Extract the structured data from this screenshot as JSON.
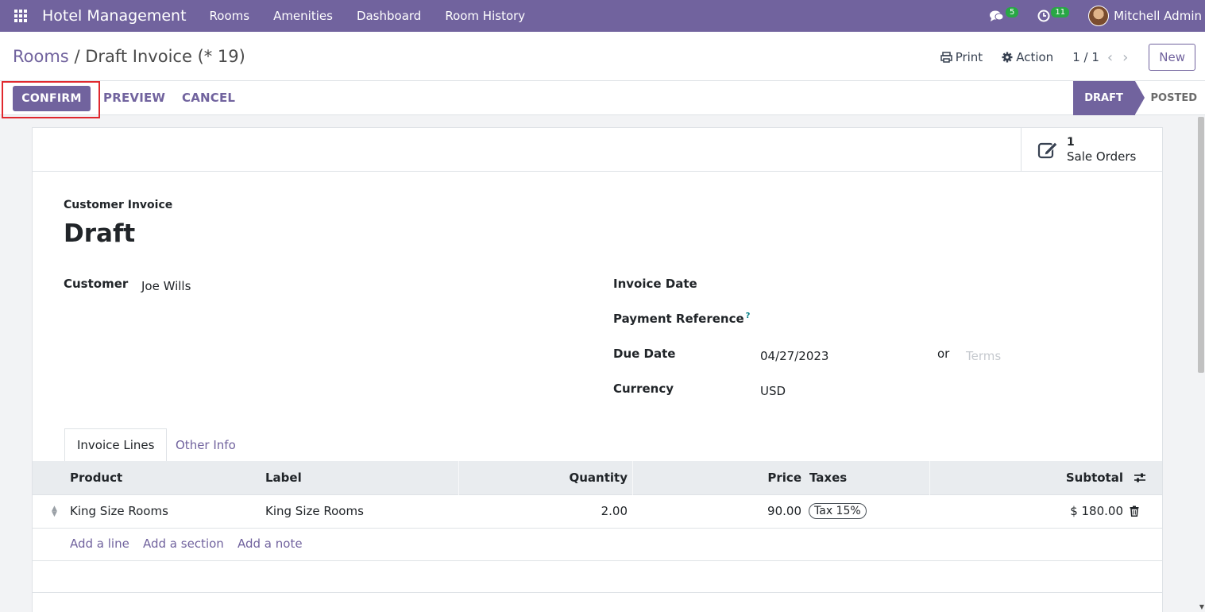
{
  "navbar": {
    "app_title": "Hotel Management",
    "menu": [
      "Rooms",
      "Amenities",
      "Dashboard",
      "Room History"
    ],
    "messages_count": "5",
    "activities_count": "11",
    "user_name": "Mitchell Admin"
  },
  "control_panel": {
    "breadcrumb_parent": "Rooms",
    "breadcrumb_sep": "/",
    "breadcrumb_current": "Draft Invoice (* 19)",
    "print_label": "Print",
    "action_label": "Action",
    "pager": "1 / 1",
    "new_label": "New"
  },
  "statusbar": {
    "confirm_label": "CONFIRM",
    "preview_label": "PREVIEW",
    "cancel_label": "CANCEL",
    "steps": [
      "DRAFT",
      "POSTED"
    ],
    "active_step": "DRAFT"
  },
  "smart_button": {
    "count": "1",
    "label": "Sale Orders"
  },
  "form": {
    "subtitle": "Customer Invoice",
    "title": "Draft",
    "customer_label": "Customer",
    "customer_value": "Joe Wills",
    "invoice_date_label": "Invoice Date",
    "payment_reference_label": "Payment Reference",
    "payment_reference_help": "?",
    "due_date_label": "Due Date",
    "due_date_value": "04/27/2023",
    "or_label": "or",
    "terms_placeholder": "Terms",
    "currency_label": "Currency",
    "currency_value": "USD"
  },
  "tabs": [
    "Invoice Lines",
    "Other Info"
  ],
  "lines_table": {
    "headers": [
      "Product",
      "Label",
      "Quantity",
      "Price",
      "Taxes",
      "Subtotal"
    ],
    "rows": [
      {
        "product": "King Size Rooms",
        "label": "King Size Rooms",
        "quantity": "2.00",
        "price": "90.00",
        "taxes": "Tax 15%",
        "subtotal": "$ 180.00"
      }
    ],
    "add_links": [
      "Add a line",
      "Add a section",
      "Add a note"
    ]
  },
  "colors": {
    "brand": "#71639e",
    "highlight": "#e0282e",
    "badge": "#28a745"
  }
}
